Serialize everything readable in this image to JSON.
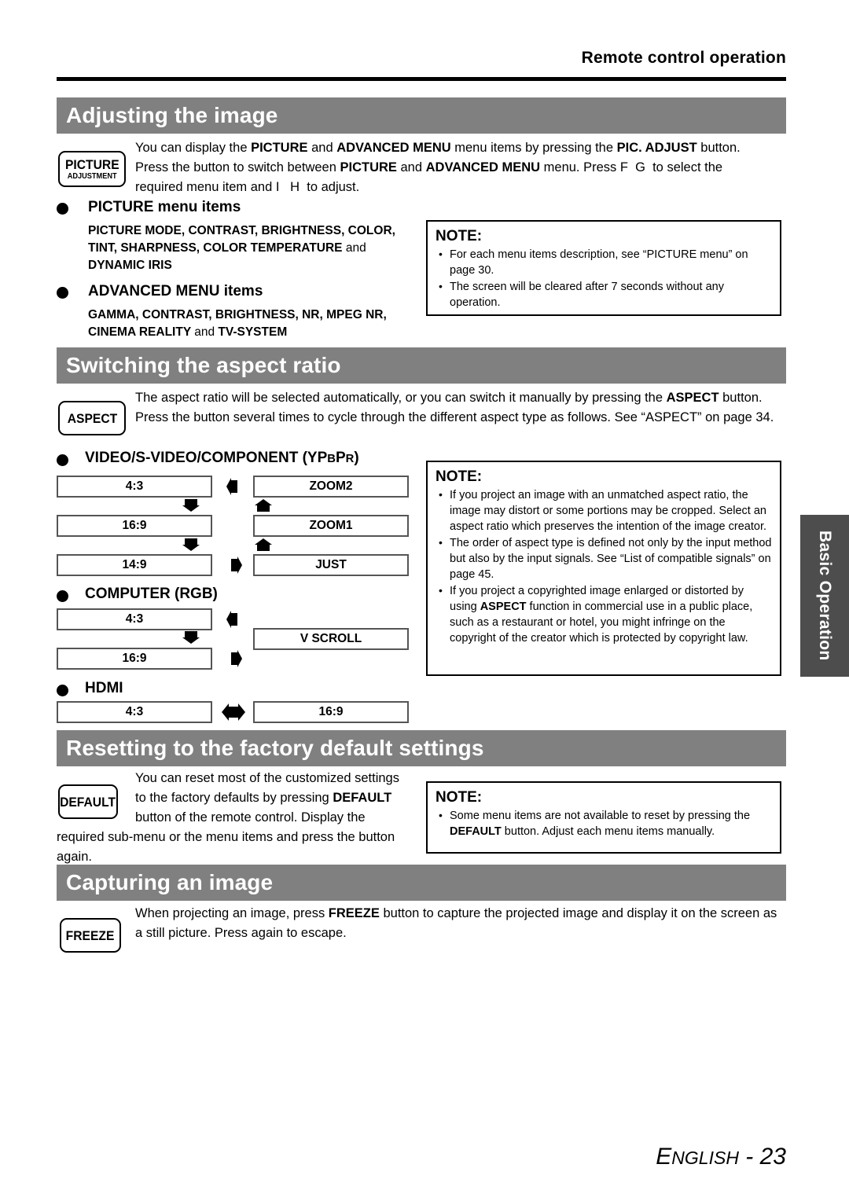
{
  "header": {
    "running_head": "Remote control operation"
  },
  "sections": [
    {
      "id": "adjusting-the-image",
      "title": "Adjusting the image",
      "key_button": {
        "line1": "PICTURE",
        "line2": "ADJUSTMENT"
      },
      "intro_html": "You can display the <b>PICTURE</b> and <b>ADVANCED MENU</b> menu items by pressing the <b>PIC. ADJUST</b> button. Press the button to switch between <b>PICTURE</b> and <b>ADVANCED MENU</b> menu. Press F&nbsp;&nbsp;G&nbsp; to select the required menu item and I&nbsp;&nbsp;&nbsp;H&nbsp; to adjust.",
      "groups": [
        {
          "heading": "PICTURE menu items",
          "items_html": "PICTURE MODE, CONTRAST, BRIGHTNESS, COLOR, TINT, SHARPNESS, COLOR TEMPERATURE <span class=\"reg\">and</span> DYNAMIC IRIS"
        },
        {
          "heading": "ADVANCED MENU items",
          "items_html": "GAMMA, CONTRAST, BRIGHTNESS, NR, MPEG NR, CINEMA REALITY <span class=\"reg\">and</span> TV-SYSTEM"
        }
      ],
      "note": {
        "title": "NOTE:",
        "items_html": [
          "For each menu items description, see “PICTURE menu” on page 30.",
          "The screen will be cleared after 7 seconds without any operation."
        ]
      }
    },
    {
      "id": "switching-the-aspect-ratio",
      "title": "Switching the aspect ratio",
      "key_button": {
        "line1": "ASPECT",
        "line2": ""
      },
      "intro_html": "The aspect ratio will be selected automatically, or you can switch it manually by pressing the <b>ASPECT</b> button. Press the button several times to cycle through the different aspect type as follows. See “ASPECT” on page 34.",
      "flows": [
        {
          "heading_html": "VIDEO/S-VIDEO/COMPONENT (YP<span style=\"font-size:0.78em\">B</span>P<span style=\"font-size:0.78em\">R</span>)",
          "left_boxes": [
            "4:3",
            "16:9",
            "14:9"
          ],
          "right_boxes": [
            "ZOOM2",
            "ZOOM1",
            "JUST"
          ]
        },
        {
          "heading_html": "COMPUTER (RGB)",
          "left_boxes": [
            "4:3",
            "16:9"
          ],
          "right_boxes": [
            "V SCROLL"
          ]
        },
        {
          "heading_html": "HDMI",
          "left_boxes": [
            "4:3"
          ],
          "right_boxes": [
            "16:9"
          ]
        }
      ],
      "note": {
        "title": "NOTE:",
        "items_html": [
          "If you project an image with an unmatched aspect ratio, the image may distort or some portions may be cropped. Select an aspect ratio which preserves the intention of the image creator.",
          "The order of aspect type is defined not only by the input method but also by the input signals. See “List of compatible signals” on page 45.",
          "If you project a copyrighted image enlarged or distorted by using <b>ASPECT</b> function in commercial use in a public place, such as a restaurant or hotel, you might infringe on the copyright of the creator which is protected by copyright law."
        ]
      }
    },
    {
      "id": "resetting-to-the-factory-default-settings",
      "title": "Resetting to the factory default settings",
      "key_button": {
        "line1": "DEFAULT",
        "line2": ""
      },
      "intro_html": "You can reset most of the customized settings to the factory defaults by pressing <b>DEFAULT</b> button of the remote control. Display the required sub-menu or the menu items and press the button again.",
      "note": {
        "title": "NOTE:",
        "items_html": [
          "Some menu items are not available to reset by pressing the <b>DEFAULT</b> button. Adjust each menu items manually."
        ]
      }
    },
    {
      "id": "capturing-an-image",
      "title": "Capturing an image",
      "key_button": {
        "line1": "FREEZE",
        "line2": ""
      },
      "intro_html": "When projecting an image, press <b>FREEZE</b> button to capture the projected image and display it on the screen as a still picture. Press again to escape."
    }
  ],
  "side_tab": {
    "label": "Basic Operation"
  },
  "footer": {
    "language": "ENGLISH",
    "separator": "-",
    "page": "23"
  },
  "colors": {
    "section_bar": "#808080",
    "side_tab": "#4d4d4d",
    "rule": "#000000"
  }
}
